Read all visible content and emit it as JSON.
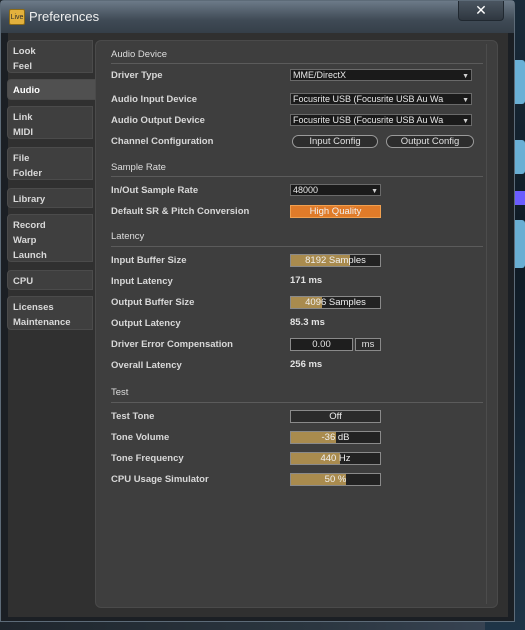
{
  "window": {
    "title": "Preferences",
    "app_icon_label": "Live",
    "close_glyph": "✕"
  },
  "tabs": [
    {
      "lines": [
        "Look",
        "Feel"
      ]
    },
    {
      "lines": [
        "Audio"
      ]
    },
    {
      "lines": [
        "Link",
        "MIDI"
      ]
    },
    {
      "lines": [
        "File",
        "Folder"
      ]
    },
    {
      "lines": [
        "Library"
      ]
    },
    {
      "lines": [
        "Record",
        "Warp",
        "Launch"
      ]
    },
    {
      "lines": [
        "CPU"
      ]
    },
    {
      "lines": [
        "Licenses",
        "Maintenance"
      ]
    }
  ],
  "active_tab": "Audio",
  "audio_device": {
    "heading": "Audio Device",
    "driver_type": {
      "label": "Driver Type",
      "value": "MME/DirectX"
    },
    "input_device": {
      "label": "Audio Input Device",
      "value": "Focusrite USB (Focusrite USB Au Wa"
    },
    "output_device": {
      "label": "Audio Output Device",
      "value": "Focusrite USB (Focusrite USB Au Wa"
    },
    "channel_config": {
      "label": "Channel Configuration",
      "input_button": "Input Config",
      "output_button": "Output Config"
    }
  },
  "sample_rate": {
    "heading": "Sample Rate",
    "in_out": {
      "label": "In/Out Sample Rate",
      "value": "48000"
    },
    "default_sr": {
      "label": "Default SR & Pitch Conversion",
      "value": "High Quality"
    }
  },
  "latency": {
    "heading": "Latency",
    "input_buffer": {
      "label": "Input Buffer Size",
      "value": "8192 Samples",
      "fill": 0.66
    },
    "input_latency": {
      "label": "Input Latency",
      "value": "171 ms"
    },
    "output_buffer": {
      "label": "Output Buffer Size",
      "value": "4096 Samples",
      "fill": 0.35
    },
    "output_latency": {
      "label": "Output Latency",
      "value": "85.3 ms"
    },
    "error_comp": {
      "label": "Driver Error Compensation",
      "value": "0.00",
      "unit": "ms"
    },
    "overall": {
      "label": "Overall Latency",
      "value": "256 ms"
    }
  },
  "test": {
    "heading": "Test",
    "tone": {
      "label": "Test Tone",
      "value": "Off"
    },
    "volume": {
      "label": "Tone Volume",
      "value": "-36 dB",
      "fill": 0.5
    },
    "frequency": {
      "label": "Tone Frequency",
      "value": "440 Hz",
      "fill": 0.55
    },
    "cpu_sim": {
      "label": "CPU Usage Simulator",
      "value": "50 %",
      "fill": 0.62
    }
  },
  "colors": {
    "accent_orange": "#e07b29",
    "slider_fill": "#a98b4e",
    "panel": "#3e3e3e"
  }
}
